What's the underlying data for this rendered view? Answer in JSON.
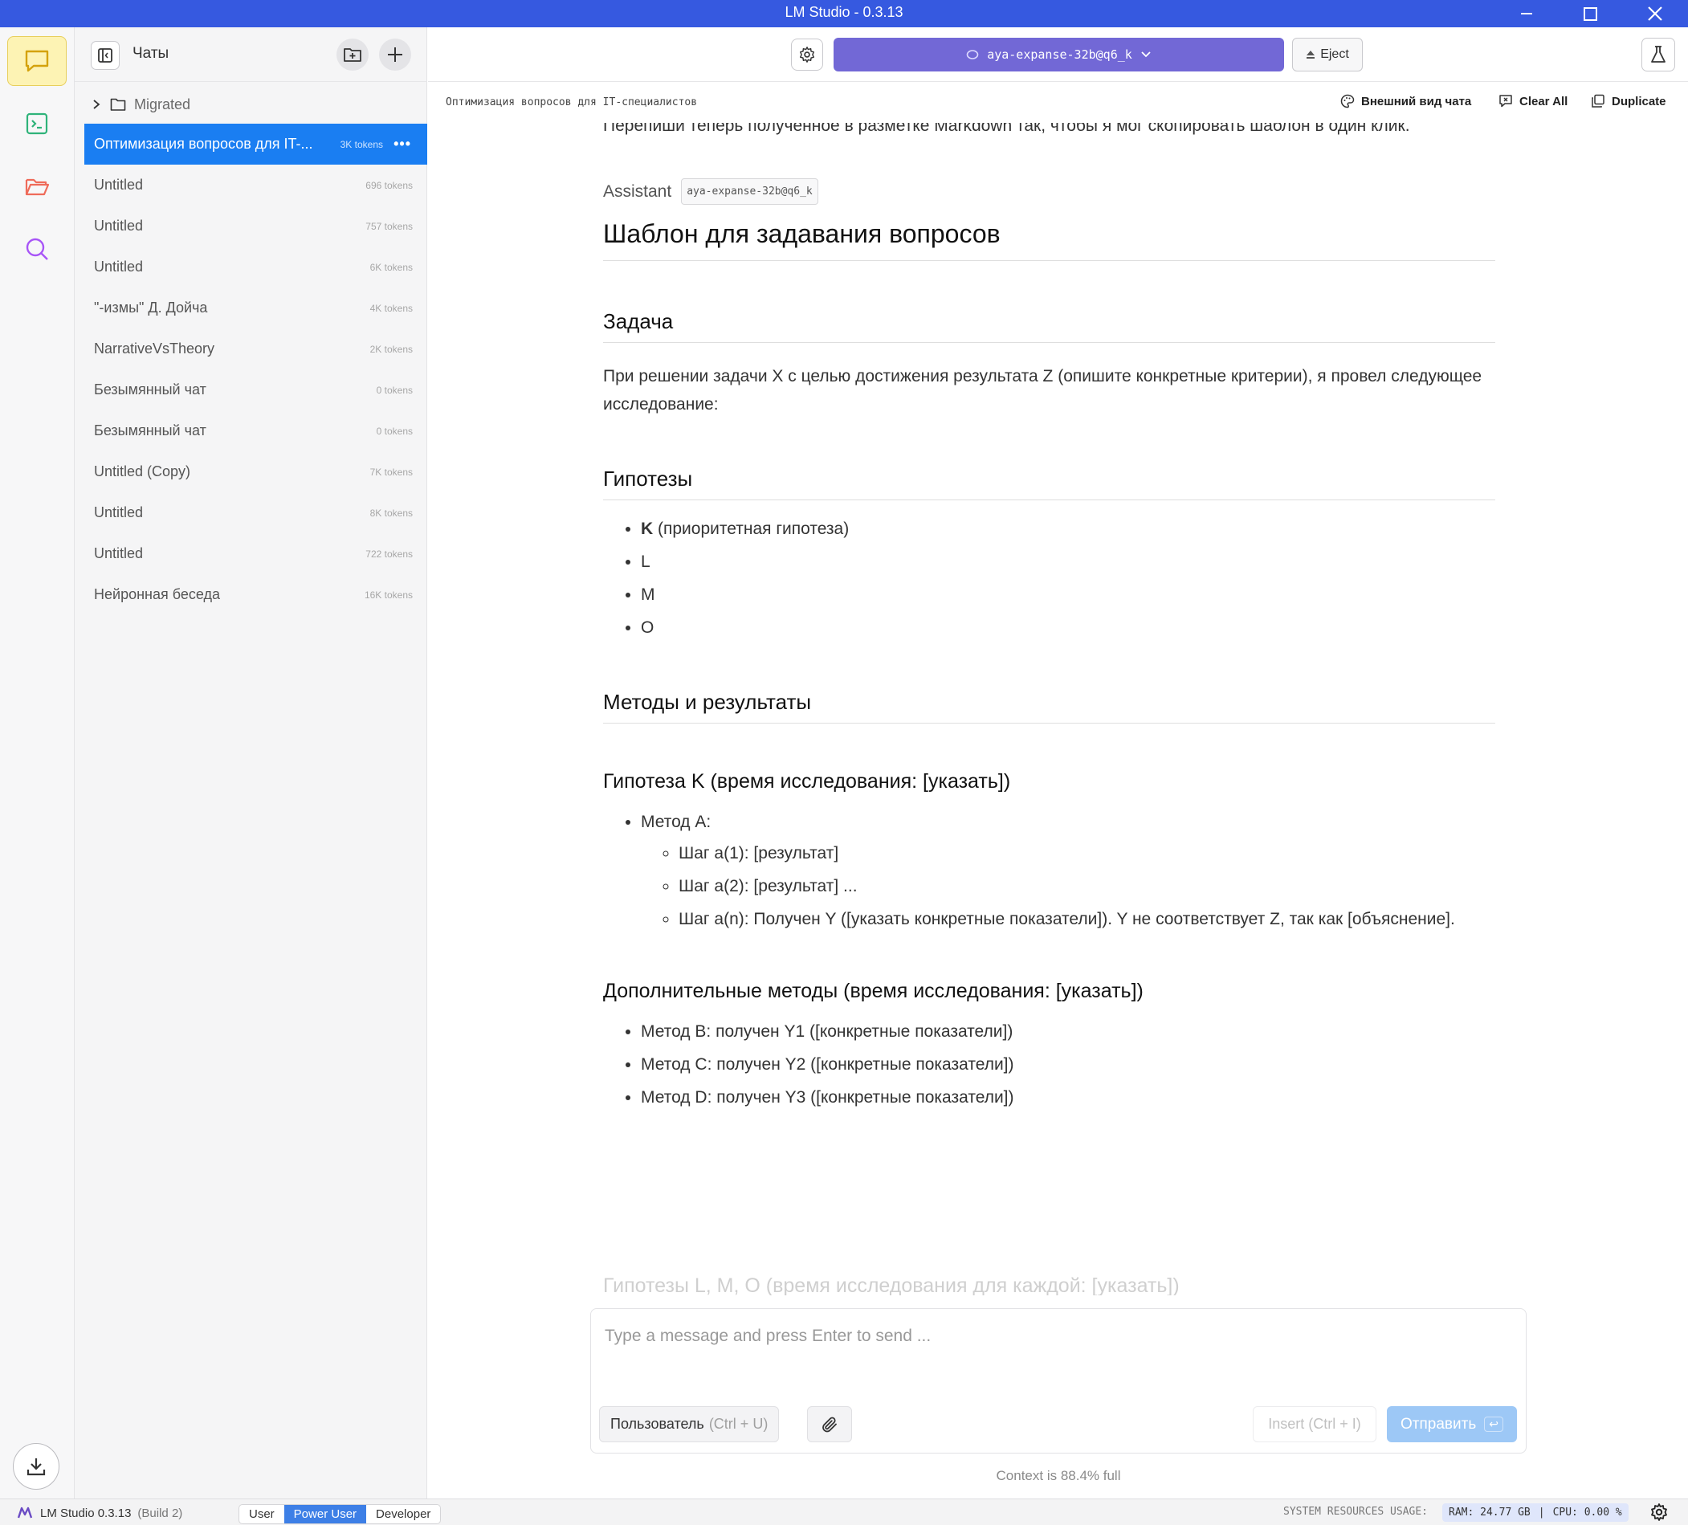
{
  "window": {
    "title": "LM Studio - 0.3.13"
  },
  "sidebar": {
    "title": "Чаты",
    "folder": {
      "name": "Migrated"
    },
    "chats": [
      {
        "name": "Оптимизация вопросов для IT-...",
        "tokens": "3K tokens",
        "active": true
      },
      {
        "name": "Untitled",
        "tokens": "696 tokens"
      },
      {
        "name": "Untitled",
        "tokens": "757 tokens"
      },
      {
        "name": "Untitled",
        "tokens": "6K tokens"
      },
      {
        "name": "\"-измы\" Д. Дойча",
        "tokens": "4K tokens"
      },
      {
        "name": "NarrativeVsTheory",
        "tokens": "2K tokens"
      },
      {
        "name": "Безымянный чат",
        "tokens": "0 tokens"
      },
      {
        "name": "Безымянный чат",
        "tokens": "0 tokens"
      },
      {
        "name": "Untitled (Copy)",
        "tokens": "7K tokens"
      },
      {
        "name": "Untitled",
        "tokens": "8K tokens"
      },
      {
        "name": "Untitled",
        "tokens": "722 tokens"
      },
      {
        "name": "Нейронная беседа",
        "tokens": "16K tokens"
      }
    ]
  },
  "topbar": {
    "model": "aya-expanse-32b@q6_k",
    "eject": "Eject"
  },
  "subbar": {
    "chat_title": "Оптимизация вопросов для IT-специалистов",
    "appearance": "Внешний вид чата",
    "clear_all": "Clear All",
    "duplicate": "Duplicate"
  },
  "conversation": {
    "user_message_tail": "Перепиши теперь полученное в разметке Markdown так, чтобы я мог скопировать шаблон в один клик.",
    "assistant_label": "Assistant",
    "assistant_model": "aya-expanse-32b@q6_k",
    "h1": "Шаблон для задавания вопросов",
    "task_heading": "Задача",
    "task_text": "При решении задачи X с целью достижения результата Z (опишите конкретные критерии), я провел следующее исследование:",
    "hypotheses_heading": "Гипотезы",
    "hypotheses": [
      {
        "bold": "K",
        "rest": " (приоритетная гипотеза)"
      },
      {
        "bold": "",
        "rest": "L"
      },
      {
        "bold": "",
        "rest": "M"
      },
      {
        "bold": "",
        "rest": "O"
      }
    ],
    "methods_heading": "Методы и результаты",
    "hypK_heading": "Гипотеза K (время исследования: [указать])",
    "methodA": "Метод A:",
    "methodA_steps": [
      "Шаг a(1): [результат]",
      "Шаг a(2): [результат] ...",
      "Шаг a(n): Получен Y ([указать конкретные показатели]). Y не соответствует Z, так как [объяснение]."
    ],
    "extra_heading": "Дополнительные методы (время исследования: [указать])",
    "extra_methods": [
      "Метод B: получен Y1 ([конкретные показатели])",
      "Метод C: получен Y2 ([конкретные показатели])",
      "Метод D: получен Y3 ([конкретные показатели])"
    ],
    "faded_heading": "Гипотезы L, M, O (время исследования для каждой: [указать])"
  },
  "composer": {
    "placeholder": "Type a message and press Enter to send ...",
    "role_label": "Пользователь",
    "role_shortcut": "(Ctrl + U)",
    "insert_label": "Insert",
    "insert_shortcut": "(Ctrl + I)",
    "send_label": "Отправить",
    "send_key": "↩",
    "context_note": "Context is 88.4% full"
  },
  "statusbar": {
    "app": "LM Studio 0.3.13",
    "build": "(Build 2)",
    "modes": [
      "User",
      "Power User",
      "Developer"
    ],
    "active_mode": "Power User",
    "resources_label": "SYSTEM RESOURCES USAGE:",
    "ram": "RAM: 24.77 GB",
    "cpu": "CPU: 0.00 %"
  },
  "colors": {
    "titlebar": "#3659e0",
    "model_pill": "#7268d6",
    "active_chat": "#1a7ef2",
    "send_button": "#9dc8f6"
  }
}
